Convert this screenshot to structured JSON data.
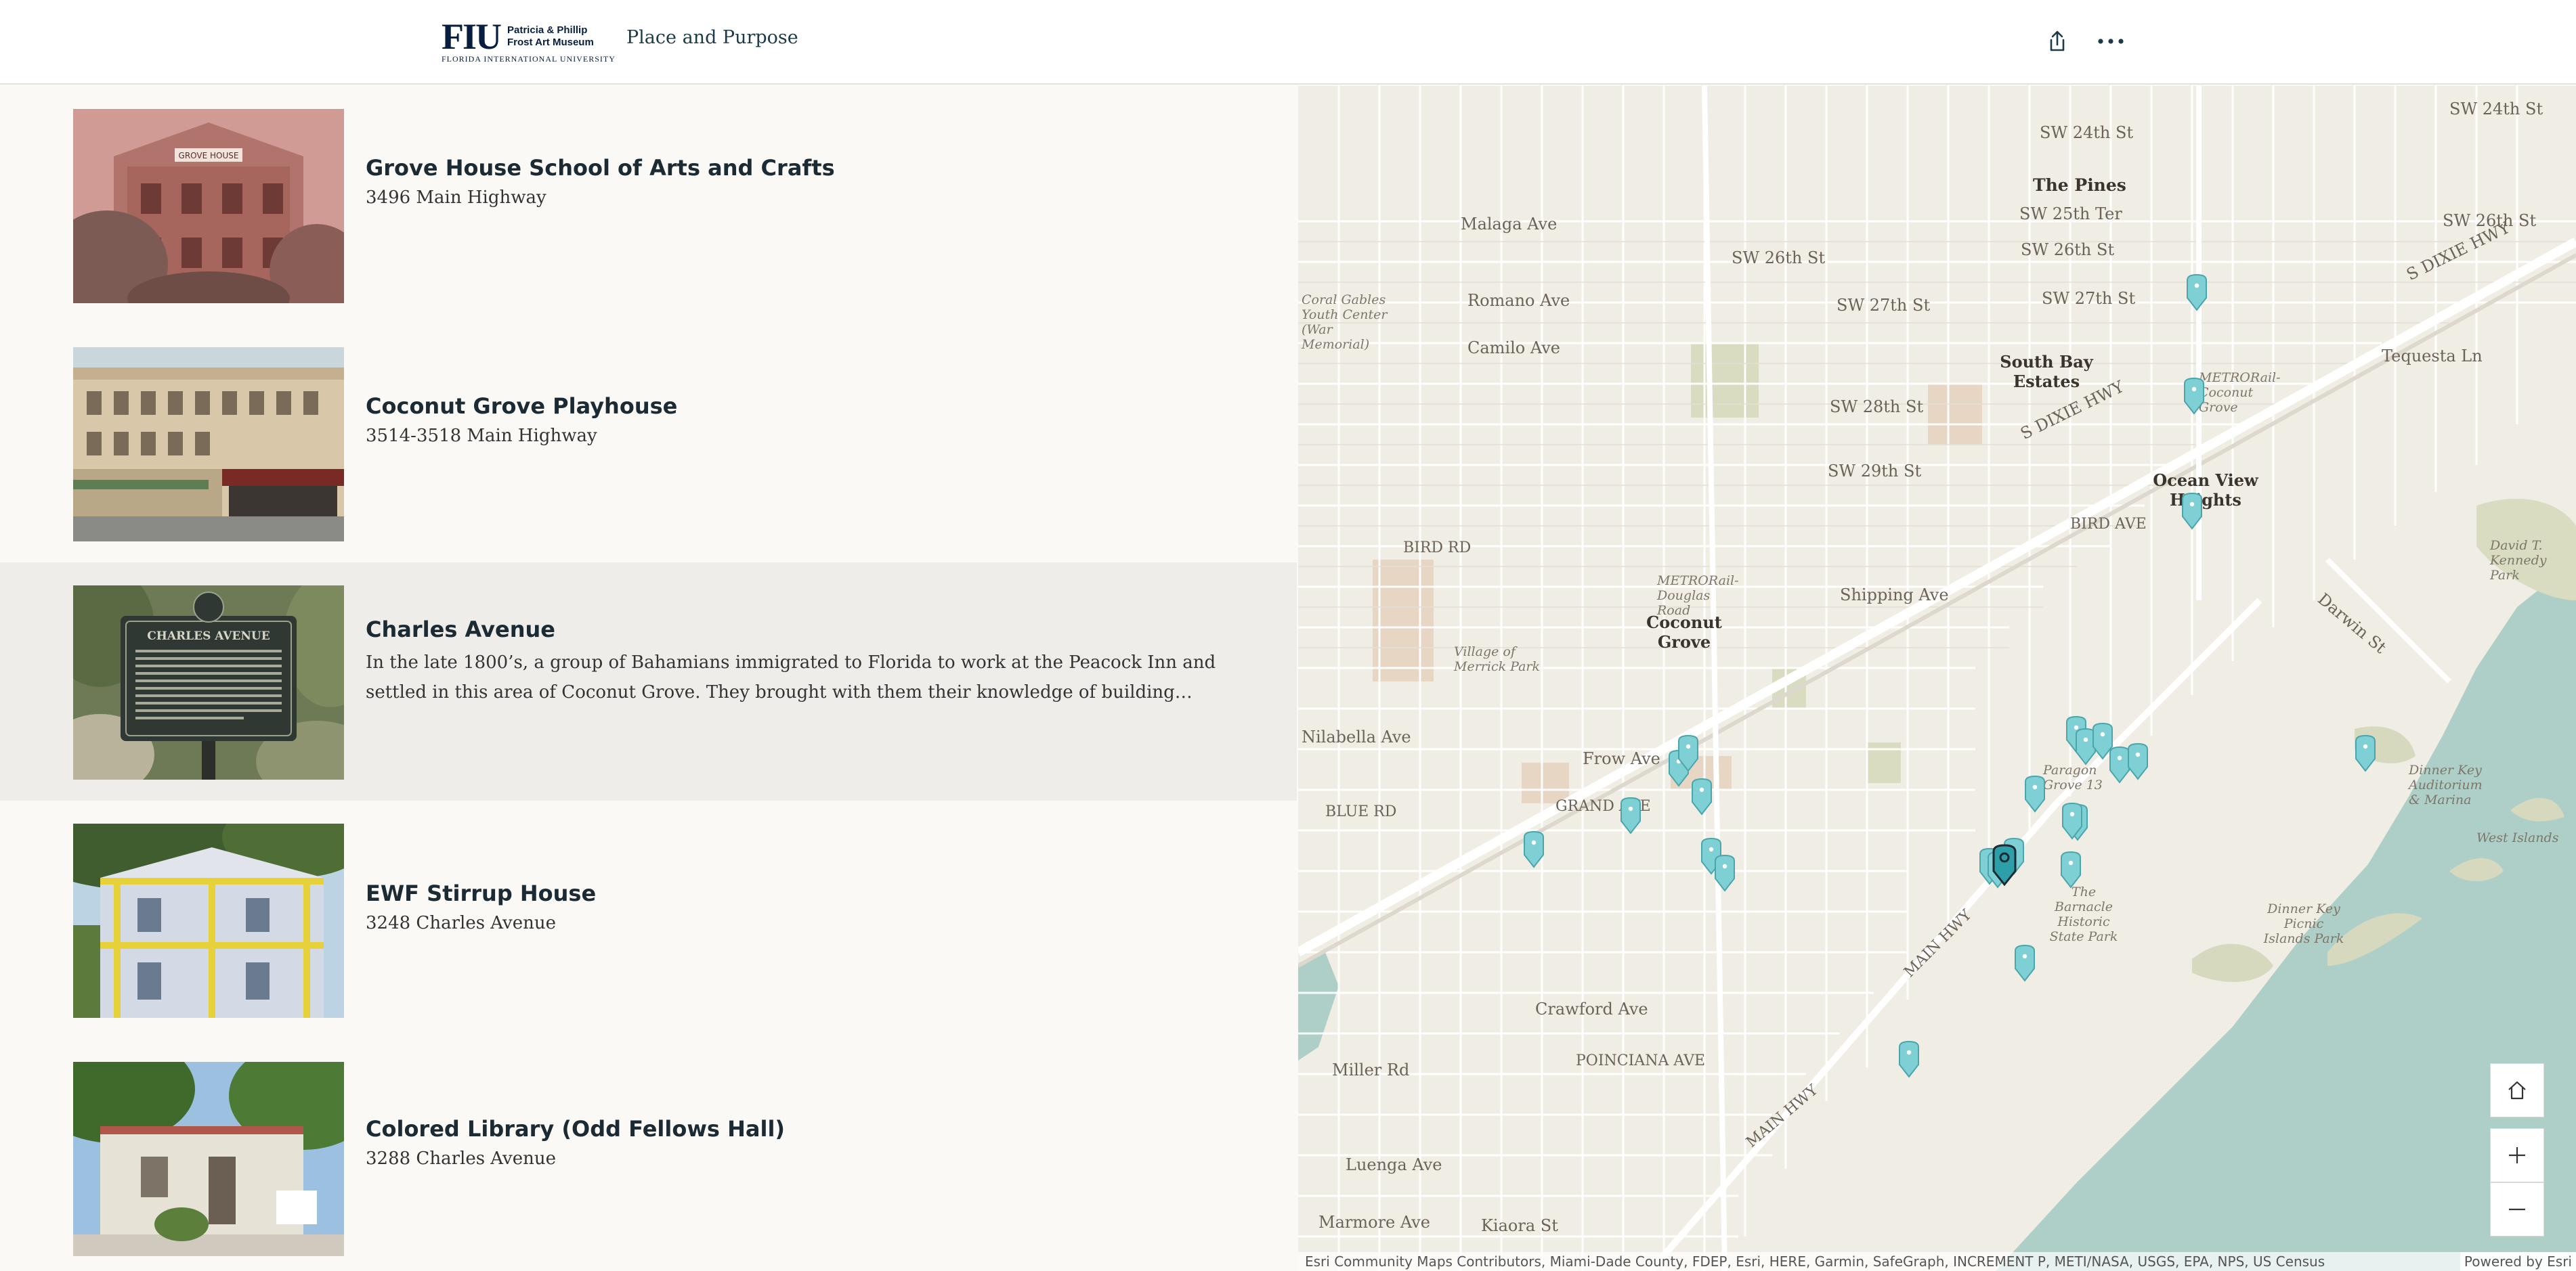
{
  "header": {
    "logo_main": "FIU",
    "logo_line1": "Patricia & Phillip",
    "logo_line2": "Frost Art Museum",
    "logo_sub": "FLORIDA INTERNATIONAL UNIVERSITY",
    "title": "Place and Purpose",
    "share_icon": "share-icon",
    "more_icon": "more-options-icon"
  },
  "list": {
    "items": [
      {
        "title": "Grove House School of Arts and Crafts",
        "subtitle": "3496 Main Highway",
        "description": "",
        "image_sign": "GROVE HOUSE"
      },
      {
        "title": "Coconut Grove Playhouse",
        "subtitle": "3514-3518 Main Highway",
        "description": ""
      },
      {
        "title": "Charles Avenue",
        "subtitle": "",
        "description": "In the late 1800’s, a group of Bahamians immigrated to Florida to work at the Peacock Inn and settled in this area of Coconut Grove. They brought with them their knowledge of building practic…",
        "image_sign": "CHARLES AVENUE"
      },
      {
        "title": "EWF Stirrup House",
        "subtitle": "3248 Charles Avenue",
        "description": ""
      },
      {
        "title": "Colored Library (Odd Fellows Hall)",
        "subtitle": "3288 Charles Avenue",
        "description": ""
      }
    ]
  },
  "map": {
    "labels": {
      "sw24": "SW 24th St",
      "sw24b": "SW 24th St",
      "sw25ter": "SW 25th Ter",
      "sw26": "SW 26th St",
      "sw26b": "SW 26th St",
      "sw26c": "SW 26th St",
      "sw27": "SW 27th St",
      "sw27b": "SW 27th St",
      "sw28": "SW 28th St",
      "sw29": "SW 29th St",
      "malaga": "Malaga Ave",
      "romano": "Romano Ave",
      "camilo": "Camilo Ave",
      "bird": "Bird Rd",
      "birdave": "Bird Ave",
      "shipping": "Shipping Ave",
      "frow": "Frow Ave",
      "grand": "Grand Ave",
      "blue": "Blue Rd",
      "nilabella": "Nilabella Ave",
      "crawford": "Crawford Ave",
      "poinciana": "Poinciana Ave",
      "miller": "Miller Rd",
      "luenga": "Luenga Ave",
      "marmore": "Marmore Ave",
      "kiaora": "Kiaora St",
      "mainhwy": "Main Hwy",
      "mainhwy2": "Main Hwy",
      "sdixie": "S Dixie Hwy",
      "sdixie2": "S Dixie Hwy",
      "tequesta": "Tequesta Ln",
      "darwin": "Darwin St",
      "pines": "The Pines",
      "southbay": "South Bay Estates",
      "oceanview": "Ocean View Heights",
      "coconutgrove": "Coconut Grove",
      "coralgables": "Coral Gables Youth Center (War Memorial)",
      "village": "Village of Merrick Park",
      "metro1": "METRORail-Douglas Road",
      "metro2": "METRORail-Coconut Grove",
      "davidkennedy": "David T. Kennedy Park",
      "dinnerkey": "Dinner Key Auditorium & Marina",
      "westisland": "West Islands",
      "dinnerpicnic": "Dinner Key Picnic Islands Park",
      "barnacle": "The Barnacle Historic State Park",
      "paragon": "Paragon Grove 13"
    },
    "home_icon": "home-icon",
    "zoom_in_icon": "zoom-in-icon",
    "zoom_out_icon": "zoom-out-icon",
    "pin_icon": "map-pin-icon",
    "attribution": "Esri Community Maps Contributors, Miami-Dade County, FDEP, Esri, HERE, Garmin, SafeGraph, INCREMENT P, METI/NASA, USGS, EPA, NPS, US Census",
    "powered_by": "Powered by Esri"
  },
  "colors": {
    "accent": "#081e3f",
    "pin_fill": "#7fd0d4",
    "pin_active": "#2c9fa8",
    "water": "#aecfc8",
    "land": "#f0ede5",
    "park": "#d9dcc0",
    "selected_row": "#eeede9"
  }
}
